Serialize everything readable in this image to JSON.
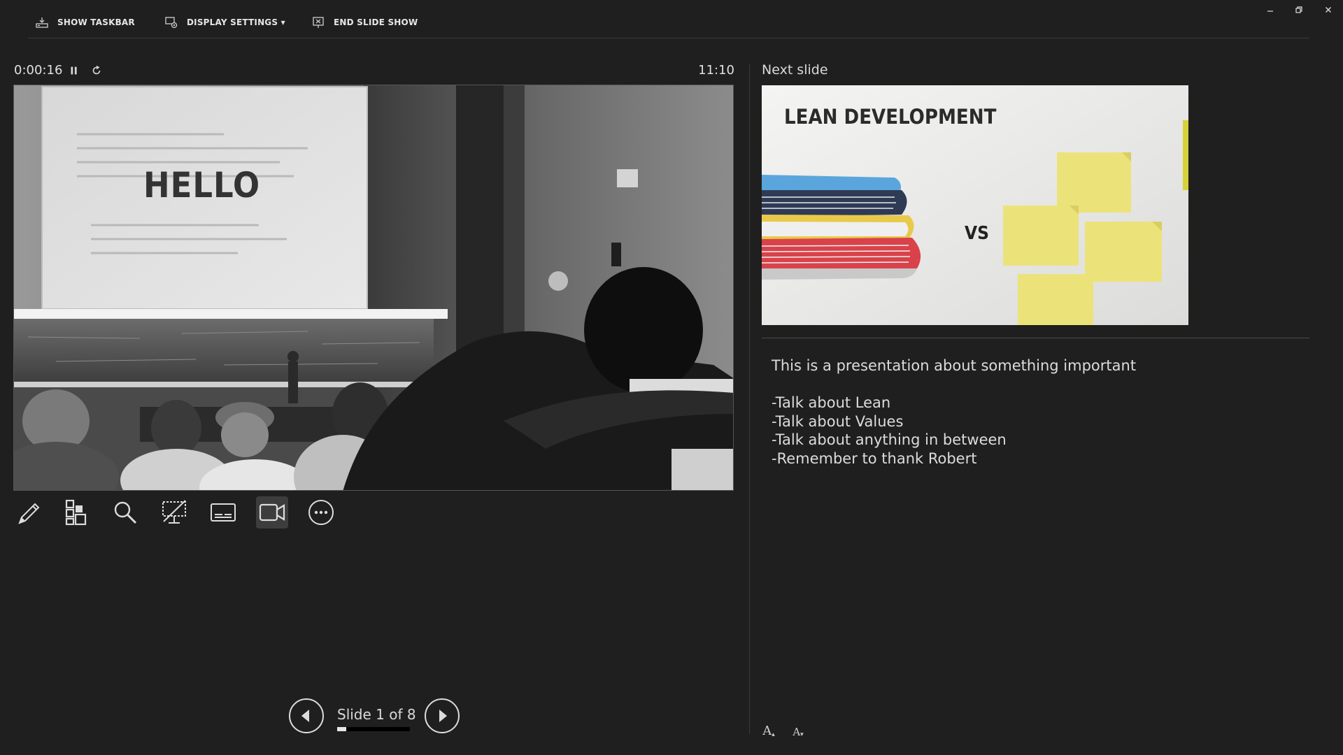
{
  "topbar": {
    "show_taskbar": "SHOW TASKBAR",
    "display_settings": "DISPLAY SETTINGS ▾",
    "end_slide_show": "END SLIDE SHOW"
  },
  "presenter": {
    "elapsed": "0:00:16",
    "clock": "11:10",
    "current_slide_title": "HELLO",
    "slide_counter": "Slide 1 of 8",
    "progress_fraction": 0.125
  },
  "next": {
    "label": "Next slide",
    "title": "LEAN DEVELOPMENT",
    "vs": "VS"
  },
  "notes": {
    "lines": [
      "This is a presentation about something important",
      "",
      "-Talk about Lean",
      "-Talk about Values",
      "-Talk about anything in between",
      "-Remember to thank Robert"
    ]
  },
  "font_controls": {
    "increase": "A",
    "decrease": "A"
  },
  "icons": {
    "tools": [
      "pen-icon",
      "slides-grid-icon",
      "zoom-icon",
      "black-screen-icon",
      "subtitles-icon",
      "camera-icon",
      "more-options-icon"
    ]
  },
  "colors": {
    "background": "#1f1f1f",
    "divider": "#3a3a3a",
    "sticky_note": "#ebe37a",
    "active_tool": "#3d3d3d"
  }
}
